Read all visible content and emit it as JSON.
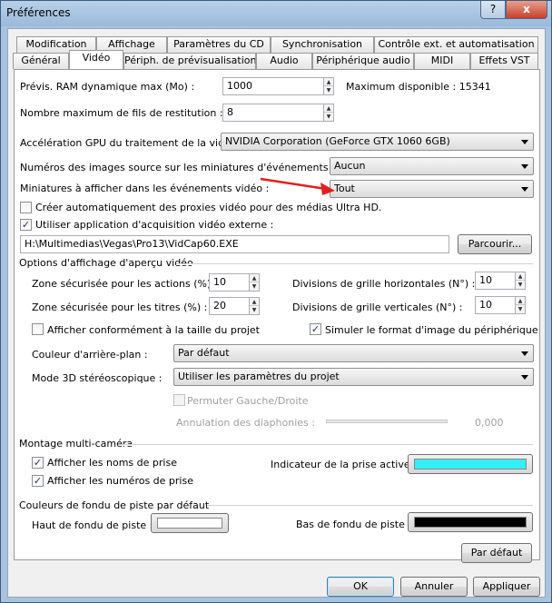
{
  "window": {
    "title": "Préférences",
    "help_label": "?",
    "close_label": "x"
  },
  "tabs_row1": [
    "Modification",
    "Affichage",
    "Paramètres du CD",
    "Synchronisation",
    "Contrôle ext. et automatisation"
  ],
  "tabs_row2": [
    "Général",
    "Vidéo",
    "Périph. de prévisualisation",
    "Audio",
    "Périphérique audio",
    "MIDI",
    "Effets VST"
  ],
  "active_tab": "Vidéo",
  "video": {
    "ram_label": "Prévis. RAM dynamique max (Mo) :",
    "ram_value": "1000",
    "ram_max_label": "Maximum disponible : 15341",
    "threads_label": "Nombre maximum de fils de restitution :",
    "threads_value": "8",
    "gpu_label": "Accélération GPU du traitement de la vidéo :",
    "gpu_value": "NVIDIA Corporation (GeForce GTX 1060 6GB)",
    "frame_numbers_label": "Numéros des images source sur les miniatures d'événements comme :",
    "frame_numbers_value": "Aucun",
    "thumbs_label": "Miniatures à afficher dans les événements vidéo :",
    "thumbs_value": "Tout",
    "proxies_label": "Créer automatiquement des proxies vidéo pour des médias Ultra HD.",
    "proxies_checked": false,
    "capture_label": "Utiliser application d'acquisition vidéo externe :",
    "capture_checked": true,
    "capture_path": "H:\\Multimedias\\Vegas\\Pro13\\VidCap60.EXE",
    "browse_label": "Parcourir..."
  },
  "preview": {
    "section_label": "Options d'affichage d'aperçu vidéo",
    "action_safe_label": "Zone sécurisée pour les actions (%) :",
    "action_safe_value": "10",
    "title_safe_label": "Zone sécurisée pour les titres (%) :",
    "title_safe_value": "20",
    "grid_h_label": "Divisions de grille horizontales (N°) :",
    "grid_h_value": "10",
    "grid_v_label": "Divisions de grille verticales (N°) :",
    "grid_v_value": "10",
    "project_size_label": "Afficher conformément à la taille du projet",
    "project_size_checked": false,
    "simulate_label": "Simuler le format d'image du périphérique",
    "simulate_checked": true,
    "bg_label": "Couleur d'arrière-plan :",
    "bg_value": "Par défaut",
    "stereo_label": "Mode 3D stéréoscopique :",
    "stereo_value": "Utiliser les paramètres du projet",
    "swap_label": "Permuter Gauche/Droite",
    "swap_checked": false,
    "crosstalk_label": "Annulation des diaphonies :",
    "crosstalk_value": "0,000",
    "crosstalk_level": 0
  },
  "multicam": {
    "section_label": "Montage multi-caméra",
    "take_names_label": "Afficher les noms de prise",
    "take_names_checked": true,
    "take_numbers_label": "Afficher les numéros de prise",
    "take_numbers_checked": true,
    "active_take_label": "Indicateur de la prise active :",
    "active_take_color": "#33f0f7"
  },
  "track_colors": {
    "section_label": "Couleurs de fondu de piste par défaut",
    "top_label": "Haut de fondu de piste :",
    "top_color": "#ffffff",
    "bottom_label": "Bas de fondu de piste :",
    "bottom_color": "#000000",
    "default_button": "Par défaut"
  },
  "footer": {
    "ok": "OK",
    "cancel": "Annuler",
    "apply": "Appliquer"
  },
  "check_glyph": "✓",
  "annotation_color": "#e02020"
}
